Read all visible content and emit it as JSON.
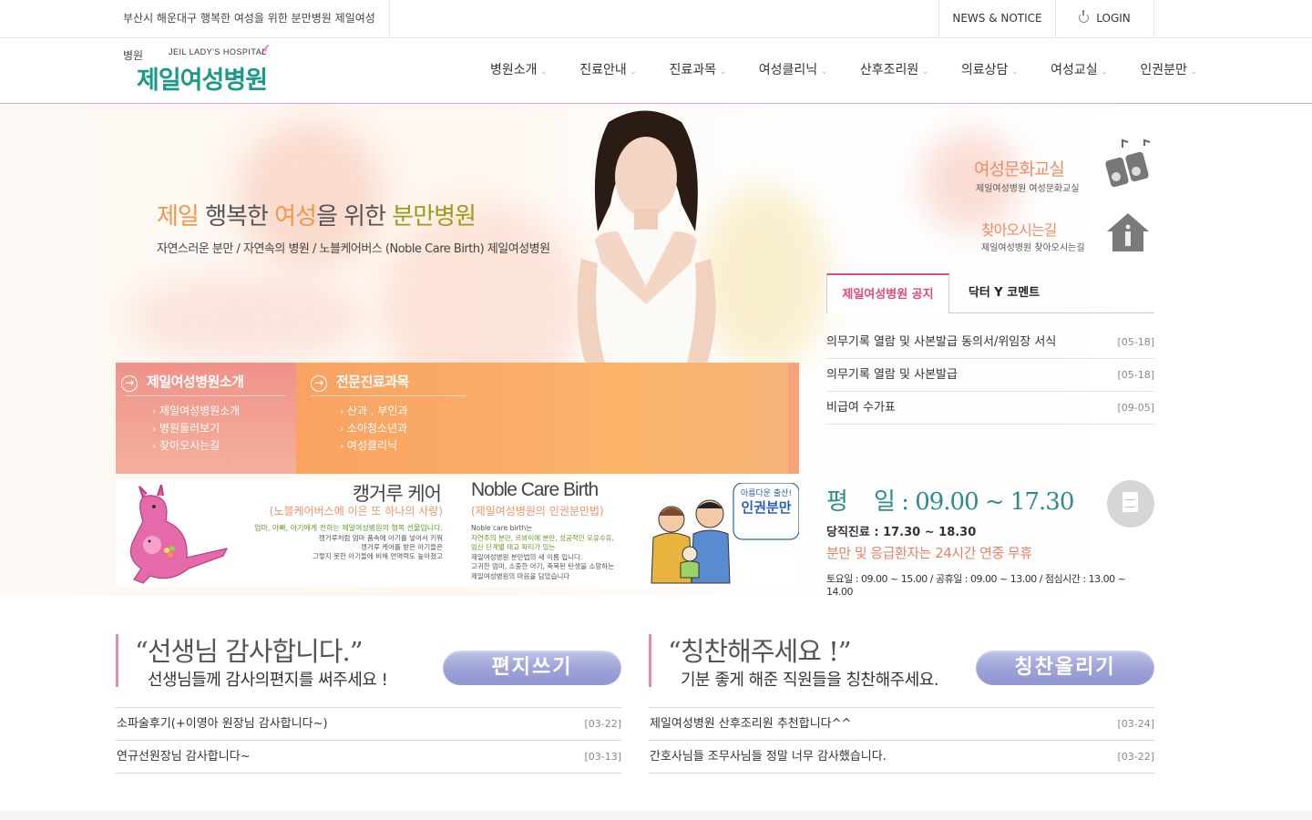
{
  "topbar": {
    "tagline": "부산시 해운대구 행복한 여성을 위한 분만병원 제일여성병원",
    "news": "NEWS & NOTICE",
    "login": "LOGIN"
  },
  "logo": {
    "en": "JEIL LADY'S HOSPITAL",
    "ko": "제일여성병원"
  },
  "nav": [
    "병원소개",
    "진료안내",
    "진료과목",
    "여성클리닉",
    "산후조리원",
    "의료상담",
    "여성교실",
    "인권분만"
  ],
  "visual": {
    "slogan": {
      "w1": "제일",
      "w2": "행복한",
      "w3": "여성",
      "w4": "을 위한",
      "w5": "분만병원"
    },
    "subline": "자연스러운 분만 / 자연속의 병원 / 노블케어버스 (Noble Care Birth) 제일여성병원",
    "quick": [
      {
        "title": "여성문화교실",
        "sub": "제일여성병원 여성문화교실"
      },
      {
        "title": "찾아오시는길",
        "sub": "제일여성병원 찾아오시는길"
      }
    ]
  },
  "menus": [
    {
      "title": "제일여성병원소개",
      "items": [
        "제일여성병원소개",
        "병원둘러보기",
        "찾아오시는길"
      ]
    },
    {
      "title": "전문진료과목",
      "items": [
        "산과 , 부인과",
        "소아청소년과",
        "여성클리닉"
      ]
    }
  ],
  "banners": {
    "kangaroo": {
      "title": "캥거루 케어",
      "sub": "(노블케어버스에 이은 또 하나의 사랑)",
      "d1": "엄마, 아빠, 아기에게 전하는 제일여성병원의 행복 선물입니다.",
      "d2a": "캥거루처럼 엄마 품속에 아기를 넣어서 키워",
      "d2b": "캥거루 케어를 받은 아기들은",
      "d2c": "그렇지 못한 아기들에 비해 면역력도 높아졌고"
    },
    "noble": {
      "title": "Noble Care Birth",
      "sub": "(제일여성병원의 인권분만법)",
      "d1": "Noble care birth는",
      "d2": "자연주의 분만, 르봐이에 분만, 성공적인 모유수유,",
      "d3": "임산 단계별 태교 파티가 있는",
      "d4": "제일여성병원 분만법의 새 이름 입니다.",
      "d5": "고귀한 엄마, 소중한 아기, 축복된 탄생을 소망하는",
      "d6": "제일여성병원의 마음을 담았습니다",
      "bubble1": "아름다운 출산!",
      "bubble2": "인권분만"
    }
  },
  "notice_tabs": [
    "제일여성병원 공지",
    "닥터 Y 코멘트"
  ],
  "notices": [
    {
      "title": "의무기록 열람 및 사본발급 동의서/위임장 서식",
      "date": "[05-18]"
    },
    {
      "title": "의무기록 열람 및 사본발급",
      "date": "[05-18]"
    },
    {
      "title": "비급여 수가표",
      "date": "[09-05]"
    }
  ],
  "hours": {
    "weekday": "평    일 : 09.00 ~ 17.30",
    "duty": "당직진료 : 17.30 ~ 18.30",
    "emergency": "분만 및 응급환자는 24시간 연중 무휴",
    "etc": "토요일 : 09.00 ~ 15.00 / 공휴일 : 09.00 ~ 13.00 / 점심시간 : 13.00 ~ 14.00"
  },
  "boards": [
    {
      "quote": "“선생님 감사합니다.”",
      "sub": "선생님들께 감사의편지를 써주세요 !",
      "button": "편지쓰기",
      "rows": [
        {
          "title": "소파술후기(+이영아 원장님 감사합니다~)",
          "date": "[03-22]"
        },
        {
          "title": "연규선원장님 감사합니다~",
          "date": "[03-13]"
        }
      ]
    },
    {
      "quote": "“칭찬해주세요 !”",
      "sub": "기분 좋게 해준 직원들을 칭찬해주세요.",
      "button": "칭찬올리기",
      "rows": [
        {
          "title": "제일여성병원 산후조리원 추천합니다^^",
          "date": "[03-24]"
        },
        {
          "title": "간호사님들 조무사님들 정말 너무 감사했습니다.",
          "date": "[03-22]"
        }
      ]
    }
  ],
  "colors": {
    "brand": "#1b9a8a",
    "accent": "#e5487b",
    "menu_pink": "#f0928a",
    "menu_orange": "#f9a262",
    "button": "#9ea4d8"
  }
}
